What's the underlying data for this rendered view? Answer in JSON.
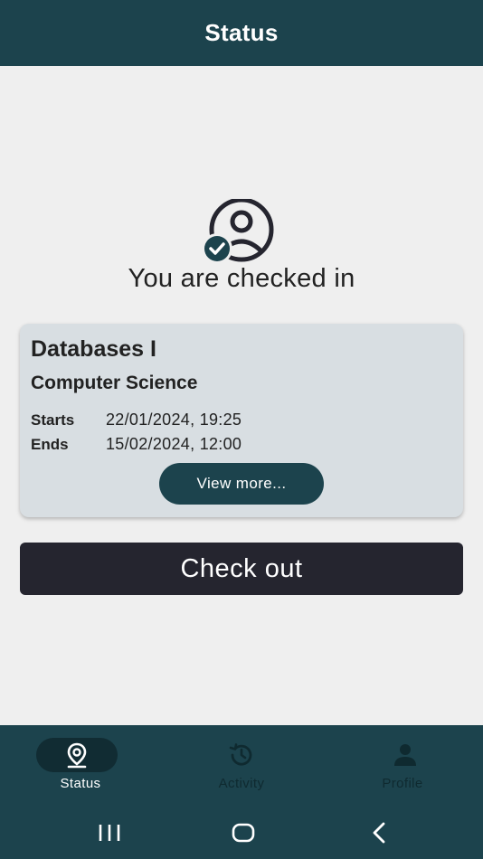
{
  "app_bar": {
    "title": "Status"
  },
  "status": {
    "message": "You are checked in",
    "icon": "user-checked-icon"
  },
  "session": {
    "course": "Databases I",
    "department": "Computer Science",
    "starts_label": "Starts",
    "starts_value": "22/01/2024, 19:25",
    "ends_label": "Ends",
    "ends_value": "15/02/2024, 12:00",
    "view_more_label": "View more..."
  },
  "checkout_label": "Check out",
  "bottom_nav": {
    "items": [
      {
        "label": "Status",
        "icon": "location-pin-icon",
        "active": true
      },
      {
        "label": "Activity",
        "icon": "history-icon",
        "active": false
      },
      {
        "label": "Profile",
        "icon": "person-icon",
        "active": false
      }
    ]
  },
  "colors": {
    "primary": "#1c434d",
    "dark_button": "#25252f",
    "card": "#d8dee2",
    "background": "#efefef"
  }
}
